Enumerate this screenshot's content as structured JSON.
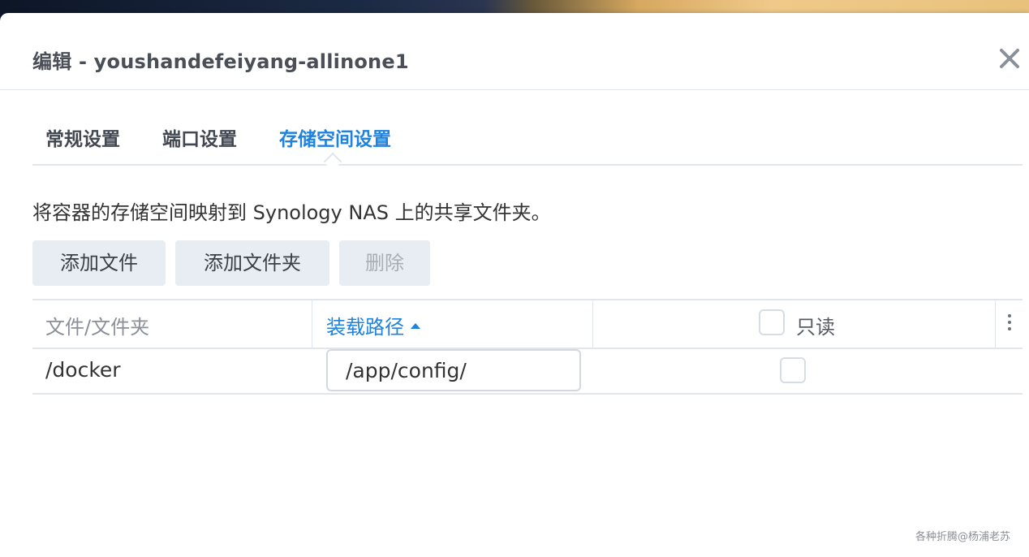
{
  "window": {
    "title": "编辑 - youshandefeiyang-allinone1"
  },
  "tabs": [
    {
      "label": "常规设置",
      "active": false
    },
    {
      "label": "端口设置",
      "active": false
    },
    {
      "label": "存储空间设置",
      "active": true
    }
  ],
  "description": "将容器的存储空间映射到 Synology NAS 上的共享文件夹。",
  "toolbar": {
    "add_file": "添加文件",
    "add_folder": "添加文件夹",
    "delete": "删除"
  },
  "table": {
    "columns": {
      "file_folder": "文件/文件夹",
      "mount_path": "装载路径",
      "readonly": "只读"
    },
    "sort": {
      "column": "mount_path",
      "direction": "ascending"
    },
    "rows": [
      {
        "file_folder": "/docker",
        "mount_path": "/app/config/",
        "readonly": false
      }
    ]
  },
  "watermark": "各种折腾@杨浦老苏",
  "colors": {
    "accent": "#1f82de",
    "button_bg": "#e8ecf3",
    "border": "#e1e5ec"
  },
  "icons": {
    "close": "close-icon",
    "sort": "sort-ascending-icon",
    "menu": "vertical-dots-icon"
  }
}
